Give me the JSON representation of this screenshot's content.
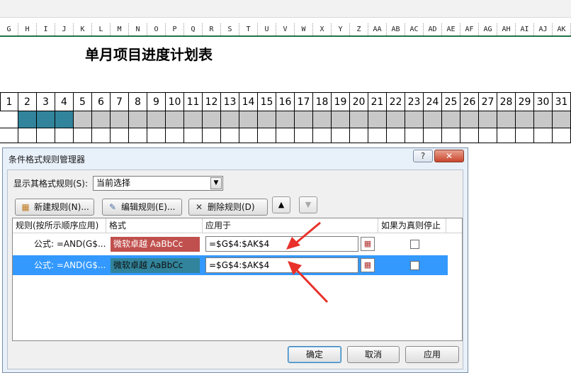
{
  "columns": [
    "G",
    "H",
    "I",
    "J",
    "K",
    "L",
    "M",
    "N",
    "O",
    "P",
    "Q",
    "R",
    "S",
    "T",
    "U",
    "V",
    "W",
    "X",
    "Y",
    "Z",
    "AA",
    "AB",
    "AC",
    "AD",
    "AE",
    "AF",
    "AG",
    "AH",
    "AI",
    "AJ",
    "AK"
  ],
  "sheet": {
    "title": "单月项目进度计划表",
    "days": [
      "1",
      "2",
      "3",
      "4",
      "5",
      "6",
      "7",
      "8",
      "9",
      "10",
      "11",
      "12",
      "13",
      "14",
      "15",
      "16",
      "17",
      "18",
      "19",
      "20",
      "21",
      "22",
      "23",
      "24",
      "25",
      "26",
      "27",
      "28",
      "29",
      "30",
      "31"
    ],
    "highlighted_days": [
      2,
      3,
      4
    ],
    "colors": {
      "teal": "#31849b",
      "gray": "#c8c8c8",
      "border": "#000000"
    }
  },
  "dialog": {
    "title": "条件格式规则管理器",
    "help_label": "?",
    "close_label": "✕",
    "show_rules_label": "显示其格式规则(S):",
    "show_rules_value": "当前选择",
    "new_rule_label": "新建规则(N)...",
    "edit_rule_label": "编辑规则(E)...",
    "delete_rule_label": "删除规则(D)",
    "move_up_icon": "▲",
    "move_down_icon": "▼",
    "headers": {
      "rule": "规则(按所示顺序应用)",
      "format": "格式",
      "applies_to": "应用于",
      "stop_if_true": "如果为真则停止"
    },
    "rules": [
      {
        "rule": "公式: =AND(G$...",
        "format_text": "微软卓越  AaBbCc",
        "format_color": "#c0504d",
        "applies_to": "=$G$4:$AK$4",
        "stop_if_true": false,
        "selected": false
      },
      {
        "rule": "公式: =AND(G$...",
        "format_text": "微软卓越  AaBbCc",
        "format_color": "#31849b",
        "applies_to": "=$G$4:$AK$4",
        "stop_if_true": false,
        "selected": true
      }
    ],
    "ok_label": "确定",
    "cancel_label": "取消",
    "apply_label": "应用"
  }
}
